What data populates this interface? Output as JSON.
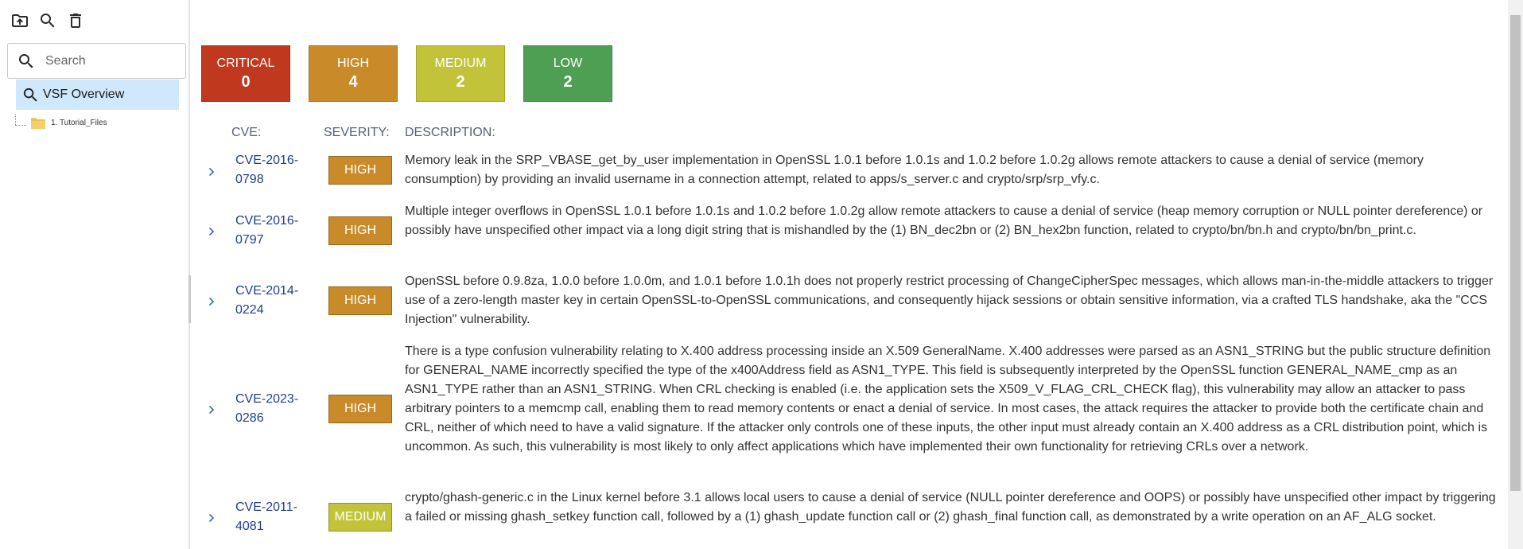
{
  "sidebar": {
    "toolbar": [
      {
        "name": "upload-folder-icon",
        "label": "Upload"
      },
      {
        "name": "search-icon",
        "label": "Search"
      },
      {
        "name": "trash-icon",
        "label": "Delete"
      }
    ],
    "search_placeholder": "Search",
    "overview_label": "VSF Overview",
    "tree_item_label": "1. Tutorial_Files"
  },
  "summary": {
    "critical": {
      "label": "CRITICAL",
      "count": "0",
      "color": "#c0391e"
    },
    "high": {
      "label": "HIGH",
      "count": "4",
      "color": "#c98b2a"
    },
    "medium": {
      "label": "MEDIUM",
      "count": "2",
      "color": "#c3c33a"
    },
    "low": {
      "label": "LOW",
      "count": "2",
      "color": "#4e9e54"
    }
  },
  "table": {
    "headers": {
      "cve": "CVE:",
      "severity": "SEVERITY:",
      "description": "DESCRIPTION:"
    },
    "rows": [
      {
        "cve": "CVE-2016-0798",
        "severity": "HIGH",
        "description": "Memory leak in the SRP_VBASE_get_by_user implementation in OpenSSL 1.0.1 before 1.0.1s and 1.0.2 before 1.0.2g allows remote attackers to cause a denial of service (memory consumption) by providing an invalid username in a connection attempt, related to apps/s_server.c and crypto/srp/srp_vfy.c."
      },
      {
        "cve": "CVE-2016-0797",
        "severity": "HIGH",
        "description": "Multiple integer overflows in OpenSSL 1.0.1 before 1.0.1s and 1.0.2 before 1.0.2g allow remote attackers to cause a denial of service (heap memory corruption or NULL pointer dereference) or possibly have unspecified other impact via a long digit string that is mishandled by the (1) BN_dec2bn or (2) BN_hex2bn function, related to crypto/bn/bn.h and crypto/bn/bn_print.c."
      },
      {
        "cve": "CVE-2014-0224",
        "severity": "HIGH",
        "description": "OpenSSL before 0.9.8za, 1.0.0 before 1.0.0m, and 1.0.1 before 1.0.1h does not properly restrict processing of ChangeCipherSpec messages, which allows man-in-the-middle attackers to trigger use of a zero-length master key in certain OpenSSL-to-OpenSSL communications, and consequently hijack sessions or obtain sensitive information, via a crafted TLS handshake, aka the \"CCS Injection\" vulnerability."
      },
      {
        "cve": "CVE-2023-0286",
        "severity": "HIGH",
        "description": "There is a type confusion vulnerability relating to X.400 address processing inside an X.509 GeneralName. X.400 addresses were parsed as an ASN1_STRING but the public structure definition for GENERAL_NAME incorrectly specified the type of the x400Address field as ASN1_TYPE. This field is subsequently interpreted by the OpenSSL function GENERAL_NAME_cmp as an ASN1_TYPE rather than an ASN1_STRING. When CRL checking is enabled (i.e. the application sets the X509_V_FLAG_CRL_CHECK flag), this vulnerability may allow an attacker to pass arbitrary pointers to a memcmp call, enabling them to read memory contents or enact a denial of service. In most cases, the attack requires the attacker to provide both the certificate chain and CRL, neither of which need to have a valid signature. If the attacker only controls one of these inputs, the other input must already contain an X.400 address as a CRL distribution point, which is uncommon. As such, this vulnerability is most likely to only affect applications which have implemented their own functionality for retrieving CRLs over a network."
      },
      {
        "cve": "CVE-2011-4081",
        "severity": "MEDIUM",
        "description": "crypto/ghash-generic.c in the Linux kernel before 3.1 allows local users to cause a denial of service (NULL pointer dereference and OOPS) or possibly have unspecified other impact by triggering a failed or missing ghash_setkey function call, followed by a (1) ghash_update function call or (2) ghash_final function call, as demonstrated by a write operation on an AF_ALG socket."
      }
    ]
  }
}
